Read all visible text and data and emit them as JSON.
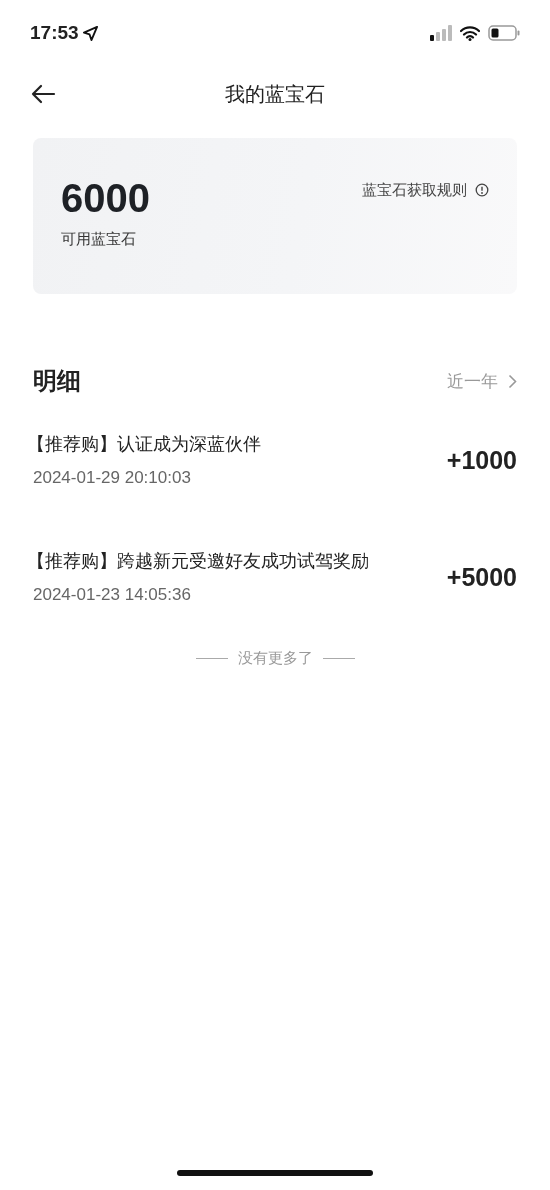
{
  "status_bar": {
    "time": "17:53"
  },
  "nav": {
    "title": "我的蓝宝石"
  },
  "balance": {
    "amount": "6000",
    "caption": "可用蓝宝石",
    "rules_link": "蓝宝石获取规则"
  },
  "details": {
    "title": "明细",
    "filter": "近一年",
    "rows": [
      {
        "title": "【推荐购】认证成为深蓝伙伴",
        "time": "2024-01-29 20:10:03",
        "amount": "+1000"
      },
      {
        "title": "【推荐购】跨越新元受邀好友成功试驾奖励",
        "time": "2024-01-23 14:05:36",
        "amount": "+5000"
      }
    ],
    "end_note": "没有更多了"
  }
}
